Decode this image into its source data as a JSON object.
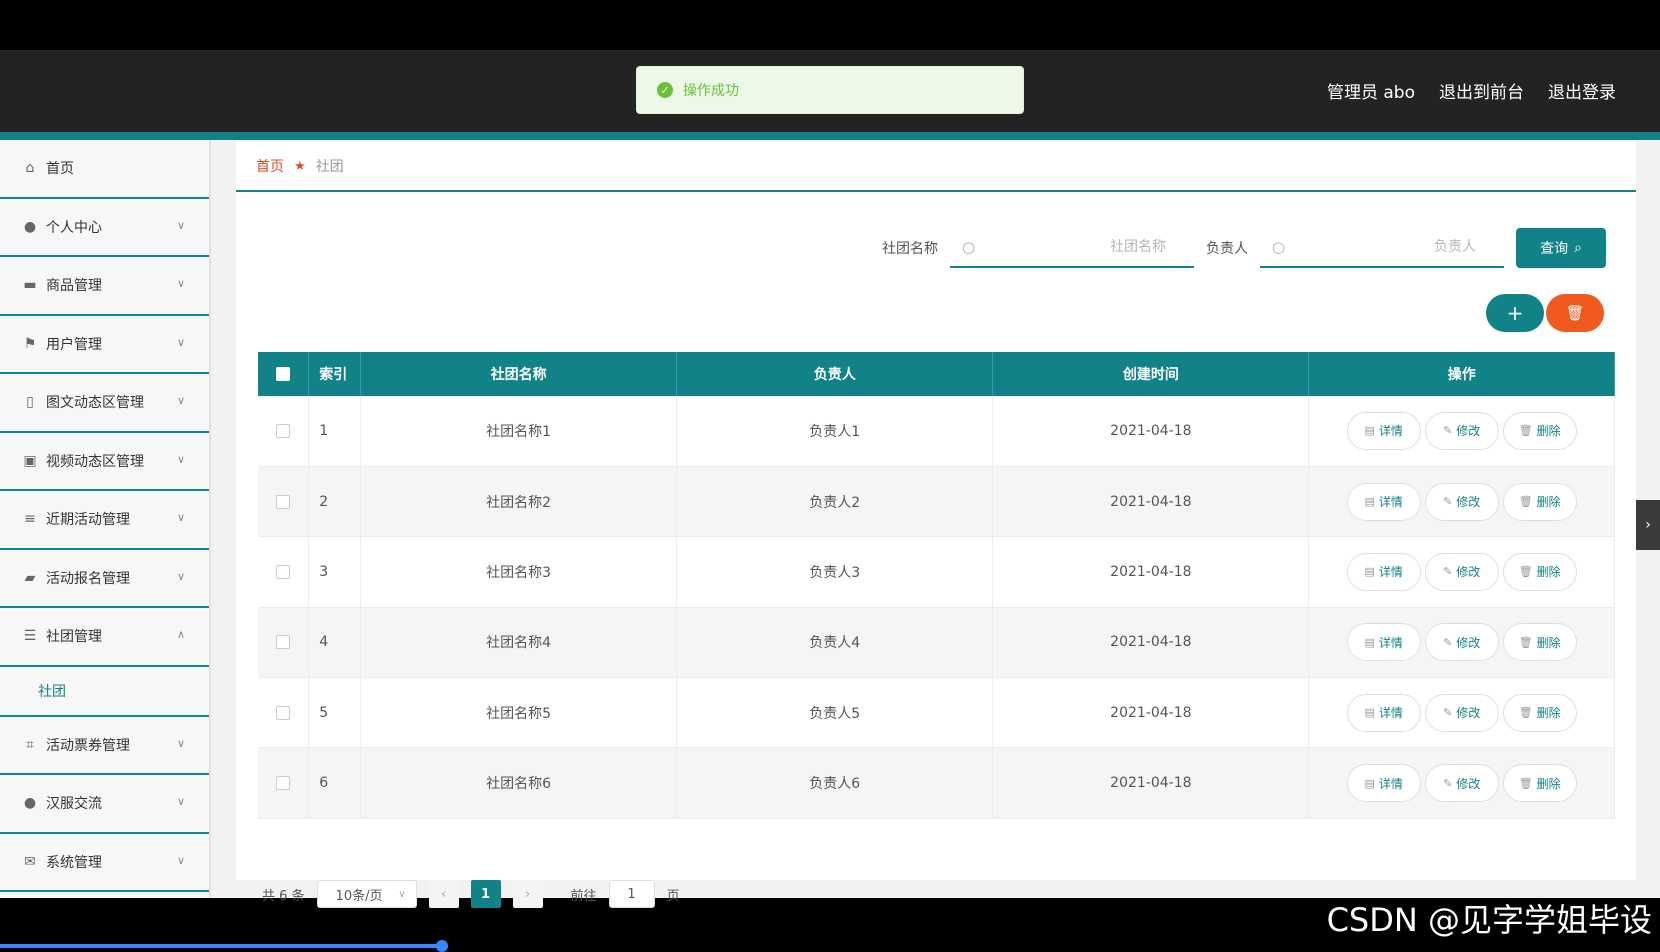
{
  "toast": {
    "message": "操作成功"
  },
  "header": {
    "user": "管理员 abo",
    "to_front": "退出到前台",
    "logout": "退出登录"
  },
  "sidebar": {
    "items": [
      {
        "label": "首页",
        "icon": "home-icon"
      },
      {
        "label": "个人中心",
        "icon": "user-icon"
      },
      {
        "label": "商品管理",
        "icon": "box-icon"
      },
      {
        "label": "用户管理",
        "icon": "flag-icon"
      },
      {
        "label": "图文动态区管理",
        "icon": "phone-icon"
      },
      {
        "label": "视频动态区管理",
        "icon": "video-icon"
      },
      {
        "label": "近期活动管理",
        "icon": "list-icon"
      },
      {
        "label": "活动报名管理",
        "icon": "chat-icon"
      },
      {
        "label": "社团管理",
        "icon": "sliders-icon"
      },
      {
        "label": "活动票券管理",
        "icon": "crop-icon"
      },
      {
        "label": "汉服交流",
        "icon": "person-icon"
      },
      {
        "label": "系统管理",
        "icon": "mail-icon"
      }
    ],
    "sub_active": "社团"
  },
  "breadcrumb": {
    "home": "首页",
    "current": "社团"
  },
  "search": {
    "name_label": "社团名称",
    "name_placeholder": "社团名称",
    "owner_label": "负责人",
    "owner_placeholder": "负责人",
    "query_label": "查询"
  },
  "table": {
    "headers": {
      "index": "索引",
      "name": "社团名称",
      "owner": "负责人",
      "created": "创建时间",
      "ops": "操作"
    },
    "ops": {
      "detail": "详情",
      "edit": "修改",
      "delete": "删除"
    },
    "rows": [
      {
        "index": "1",
        "name": "社团名称1",
        "owner": "负责人1",
        "created": "2021-04-18"
      },
      {
        "index": "2",
        "name": "社团名称2",
        "owner": "负责人2",
        "created": "2021-04-18"
      },
      {
        "index": "3",
        "name": "社团名称3",
        "owner": "负责人3",
        "created": "2021-04-18"
      },
      {
        "index": "4",
        "name": "社团名称4",
        "owner": "负责人4",
        "created": "2021-04-18"
      },
      {
        "index": "5",
        "name": "社团名称5",
        "owner": "负责人5",
        "created": "2021-04-18"
      },
      {
        "index": "6",
        "name": "社团名称6",
        "owner": "负责人6",
        "created": "2021-04-18"
      }
    ]
  },
  "pagination": {
    "total": "共 6 条",
    "page_size": "10条/页",
    "current": "1",
    "goto_prefix": "前往",
    "goto_value": "1",
    "goto_suffix": "页"
  },
  "watermark": "CSDN @见字学姐毕设",
  "colors": {
    "accent": "#118287",
    "danger": "#f05a1e",
    "header_bg": "#232323",
    "success": "#67c23a"
  }
}
